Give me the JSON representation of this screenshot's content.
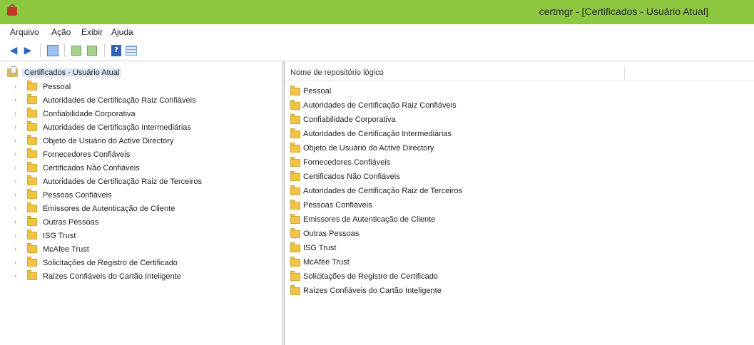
{
  "window": {
    "title": "certmgr - [Certificados - Usuário Atual]",
    "titlebar_color": "#8dc63f"
  },
  "menu": {
    "items": [
      "Arquivo",
      "Ação",
      "Exibir",
      "Ajuda"
    ]
  },
  "toolbar": {
    "icons": [
      "back-arrow-icon",
      "forward-arrow-icon",
      "console-tree-icon",
      "export-icon",
      "import-icon",
      "help-icon",
      "properties-icon"
    ]
  },
  "tree": {
    "root_label": "Certificados - Usuário Atual",
    "items": [
      "Pessoal",
      "Autoridades de Certificação Raiz Confiáveis",
      "Confiabilidade Corporativa",
      "Autoridades de Certificação Intermediárias",
      "Objeto de Usuário do Active Directory",
      "Fornecedores Confiáveis",
      "Certificados Não Confiáveis",
      "Autoridades de Certificação Raiz de Terceiros",
      "Pessoas Confiáveis",
      "Emissores de Autenticação de Cliente",
      "Outras Pessoas",
      "ISG Trust",
      "McAfee Trust",
      "Solicitações de Registro de Certificado",
      "Raízes Confiáveis do Cartão Inteligente"
    ]
  },
  "list": {
    "column_header": "Nome de repositório lógico",
    "items": [
      "Pessoal",
      "Autoridades de Certificação Raiz Confiáveis",
      "Confiabilidade Corporativa",
      "Autoridades de Certificação Intermediárias",
      "Objeto de Usuário do Active Directory",
      "Fornecedores Confiáveis",
      "Certificados Não Confiáveis",
      "Autoridades de Certificação Raiz de Terceiros",
      "Pessoas Confiáveis",
      "Emissores de Autenticação de Cliente",
      "Outras Pessoas",
      "ISG Trust",
      "McAfee Trust",
      "Solicitações de Registro de Certificado",
      "Raízes Confiáveis do Cartão Inteligente"
    ]
  }
}
